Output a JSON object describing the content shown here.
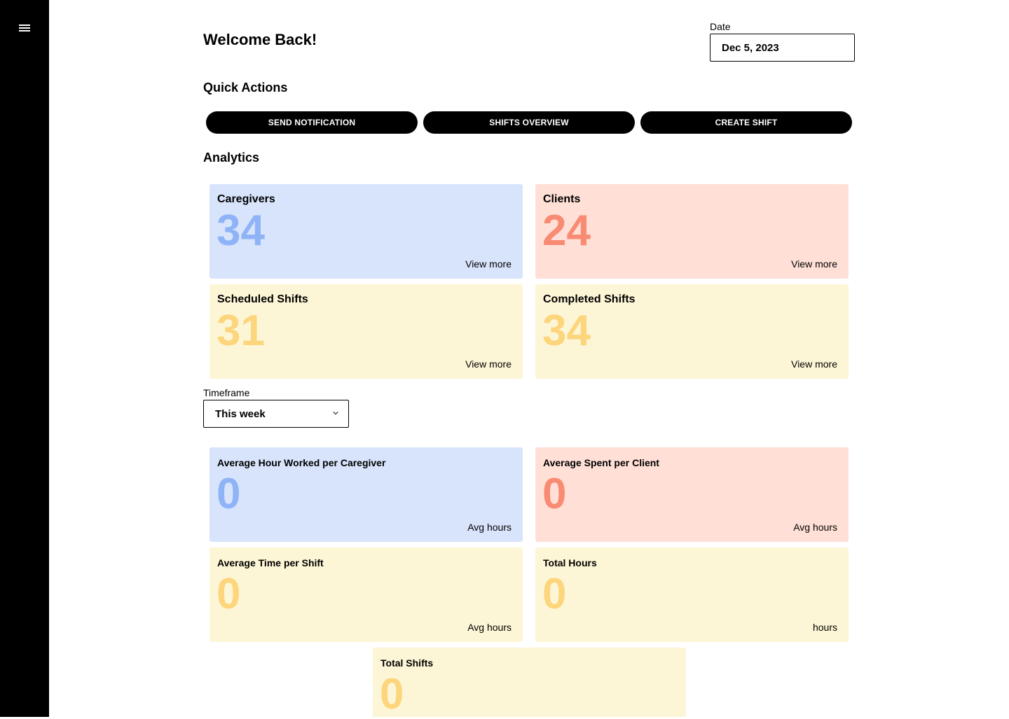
{
  "header": {
    "title": "Welcome Back!",
    "date_label": "Date",
    "date_value": "Dec 5, 2023"
  },
  "quick_actions": {
    "title": "Quick Actions",
    "buttons": [
      "SEND NOTIFICATION",
      "SHIFTS OVERVIEW",
      "CREATE SHIFT"
    ]
  },
  "analytics": {
    "title": "Analytics",
    "cards": [
      {
        "label": "Caregivers",
        "value": "34",
        "link": "View more"
      },
      {
        "label": "Clients",
        "value": "24",
        "link": "View more"
      },
      {
        "label": "Scheduled Shifts",
        "value": "31",
        "link": "View more"
      },
      {
        "label": "Completed Shifts",
        "value": "34",
        "link": "View more"
      }
    ]
  },
  "timeframe": {
    "label": "Timeframe",
    "selected": "This week"
  },
  "metrics": [
    {
      "label": "Average Hour Worked per Caregiver",
      "value": "0",
      "unit": "Avg hours"
    },
    {
      "label": "Average Spent per Client",
      "value": "0",
      "unit": "Avg hours"
    },
    {
      "label": "Average Time per Shift",
      "value": "0",
      "unit": "Avg hours"
    },
    {
      "label": "Total Hours",
      "value": "0",
      "unit": "hours"
    },
    {
      "label": "Total Shifts",
      "value": "0"
    }
  ],
  "colors": {
    "blue_card": "#d7e4fc",
    "blue_value": "#8fb3f7",
    "red_card": "#ffdfd6",
    "red_value": "#f88b72",
    "yellow_card": "#fdf6d6",
    "yellow_value": "#fcd57c",
    "sidebar": "#000000"
  },
  "icons": {
    "menu": "hamburger-menu-icon",
    "timeframe_chevron": "chevron-down-icon"
  }
}
